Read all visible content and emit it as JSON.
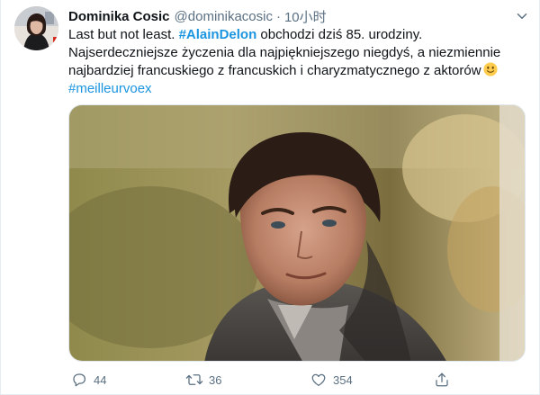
{
  "tweet": {
    "display_name": "Dominika Cosic",
    "handle": "@dominikacosic",
    "separator": "·",
    "time": "10小时",
    "text": {
      "line1_before": "Last but not least. ",
      "hashtag1": "#AlainDelon",
      "line1_after": " obchodzi dziś 85. urodziny.",
      "body": "Najserdeczniejsze życzenia dla najpiękniejszego niegdyś, a niezmiennie najbardziej francuskiego z francuskich i charyzmatycznego z aktorów",
      "hashtag2": "#meilleurvoex"
    },
    "emoji": "slightly-smiling-face-emoji"
  },
  "actions": {
    "reply_count": "44",
    "retweet_count": "36",
    "like_count": "354"
  },
  "icons": {
    "reply": "comment-icon",
    "retweet": "retweet-icon",
    "like": "heart-icon",
    "share": "share-icon",
    "more": "chevron-down-icon"
  },
  "colors": {
    "accent": "#1b95e0",
    "secondary_text": "#5b7083",
    "primary_text": "#0f1419"
  }
}
